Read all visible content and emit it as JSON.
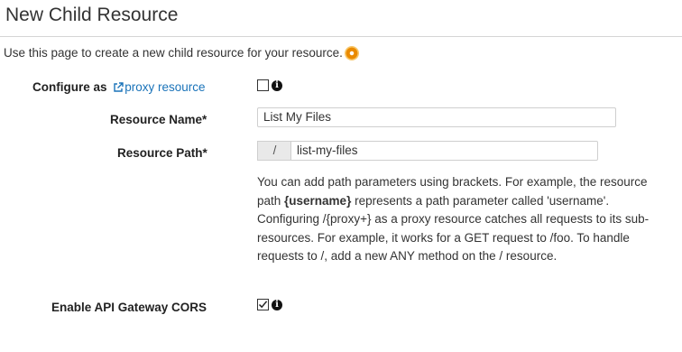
{
  "page": {
    "title": "New Child Resource",
    "intro": "Use this page to create a new child resource for your resource."
  },
  "form": {
    "proxy": {
      "label_prefix": "Configure as ",
      "link_text": "proxy resource",
      "checked": false
    },
    "resource_name": {
      "label": "Resource Name*",
      "value": "List My Files"
    },
    "resource_path": {
      "label": "Resource Path*",
      "prefix": "/",
      "value": "list-my-files"
    },
    "help": {
      "part1": "You can add path parameters using brackets. For example, the resource path ",
      "param": "{username}",
      "part2": " represents a path parameter called 'username'. Configuring /{proxy+} as a proxy resource catches all requests to its sub-resources. For example, it works for a GET request to /foo. To handle requests to /, add a new ANY method on the / resource."
    },
    "cors": {
      "label": "Enable API Gateway CORS",
      "checked": true
    }
  },
  "colors": {
    "link": "#1a73b9",
    "help_dot": "#ea8a00"
  },
  "icons": {
    "help": "help-dot-icon",
    "info": "info-icon",
    "external_link": "external-link-icon",
    "checkmark": "checkmark-icon"
  }
}
